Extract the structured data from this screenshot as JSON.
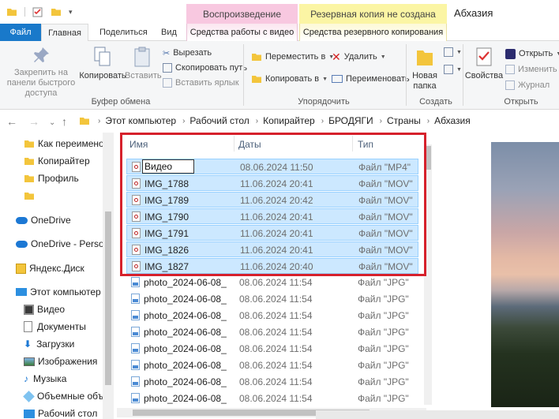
{
  "window": {
    "title": "Абхазия",
    "context_tabs": {
      "playback": "Воспроизведение",
      "backup": "Резервная копия не создана"
    }
  },
  "ribbon_tabs": {
    "file": "Файл",
    "home": "Главная",
    "share": "Поделиться",
    "view": "Вид",
    "video_tools": "Средства работы с видео",
    "backup_tools": "Средства резервного копирования"
  },
  "ribbon": {
    "pin": "Закрепить на панели быстрого доступа",
    "copy": "Копировать",
    "paste": "Вставить",
    "cut": "Вырезать",
    "copy_path": "Скопировать путь",
    "paste_shortcut": "Вставить ярлык",
    "clipboard_group": "Буфер обмена",
    "move_to": "Переместить в",
    "copy_to": "Копировать в",
    "delete": "Удалить",
    "rename": "Переименовать",
    "organize_group": "Упорядочить",
    "new_folder": "Новая папка",
    "create_group": "Создать",
    "properties": "Свойства",
    "open": "Открыть",
    "edit": "Изменить",
    "history": "Журнал",
    "open_group": "Открыть"
  },
  "breadcrumb": [
    "Этот компьютер",
    "Рабочий стол",
    "Копирайтер",
    "БРОДЯГИ",
    "Страны",
    "Абхазия"
  ],
  "nav": [
    {
      "label": "Как переимено",
      "icon": "folder-icon"
    },
    {
      "label": "Копирайтер",
      "icon": "folder-icon"
    },
    {
      "label": "Профиль",
      "icon": "folder-icon"
    },
    {
      "label": "",
      "icon": "folder-icon"
    },
    {
      "label": "OneDrive",
      "icon": "cloud-icon"
    },
    {
      "label": "OneDrive - Person",
      "icon": "cloud-icon"
    },
    {
      "label": "Яндекс.Диск",
      "icon": "yandex-disk-icon"
    },
    {
      "label": "Этот компьютер",
      "icon": "computer-icon"
    },
    {
      "label": "Видео",
      "icon": "video-folder-icon"
    },
    {
      "label": "Документы",
      "icon": "documents-icon"
    },
    {
      "label": "Загрузки",
      "icon": "downloads-icon"
    },
    {
      "label": "Изображения",
      "icon": "pictures-icon"
    },
    {
      "label": "Музыка",
      "icon": "music-icon"
    },
    {
      "label": "Объемные объ",
      "icon": "3d-objects-icon"
    },
    {
      "label": "Рабочий стол",
      "icon": "desktop-icon"
    }
  ],
  "columns": {
    "name": "Имя",
    "date": "Даты",
    "type": "Тип"
  },
  "rename_value": "Видео",
  "files": [
    {
      "name": "Видео",
      "date": "08.06.2024 11:50",
      "type": "Файл \"MP4\"",
      "kind": "video",
      "selected": true
    },
    {
      "name": "IMG_1788",
      "date": "11.06.2024 20:41",
      "type": "Файл \"MOV\"",
      "kind": "video",
      "selected": true
    },
    {
      "name": "IMG_1789",
      "date": "11.06.2024 20:42",
      "type": "Файл \"MOV\"",
      "kind": "video",
      "selected": true
    },
    {
      "name": "IMG_1790",
      "date": "11.06.2024 20:41",
      "type": "Файл \"MOV\"",
      "kind": "video",
      "selected": true
    },
    {
      "name": "IMG_1791",
      "date": "11.06.2024 20:41",
      "type": "Файл \"MOV\"",
      "kind": "video",
      "selected": true
    },
    {
      "name": "IMG_1826",
      "date": "11.06.2024 20:41",
      "type": "Файл \"MOV\"",
      "kind": "video",
      "selected": true
    },
    {
      "name": "IMG_1827",
      "date": "11.06.2024 20:40",
      "type": "Файл \"MOV\"",
      "kind": "video",
      "selected": true
    },
    {
      "name": "photo_2024-06-08_",
      "date": "08.06.2024 11:54",
      "type": "Файл \"JPG\"",
      "kind": "image",
      "selected": false
    },
    {
      "name": "photo_2024-06-08_",
      "date": "08.06.2024 11:54",
      "type": "Файл \"JPG\"",
      "kind": "image",
      "selected": false
    },
    {
      "name": "photo_2024-06-08_",
      "date": "08.06.2024 11:54",
      "type": "Файл \"JPG\"",
      "kind": "image",
      "selected": false
    },
    {
      "name": "photo_2024-06-08_",
      "date": "08.06.2024 11:54",
      "type": "Файл \"JPG\"",
      "kind": "image",
      "selected": false
    },
    {
      "name": "photo_2024-06-08_",
      "date": "08.06.2024 11:54",
      "type": "Файл \"JPG\"",
      "kind": "image",
      "selected": false
    },
    {
      "name": "photo_2024-06-08_",
      "date": "08.06.2024 11:54",
      "type": "Файл \"JPG\"",
      "kind": "image",
      "selected": false
    },
    {
      "name": "photo_2024-06-08_",
      "date": "08.06.2024 11:54",
      "type": "Файл \"JPG\"",
      "kind": "image",
      "selected": false
    },
    {
      "name": "photo_2024-06-08_",
      "date": "08.06.2024 11:54",
      "type": "Файл \"JPG\"",
      "kind": "image",
      "selected": false
    }
  ],
  "colors": {
    "accent": "#1979ca",
    "selection": "#cce8ff",
    "highlight_box": "#d6212c"
  }
}
